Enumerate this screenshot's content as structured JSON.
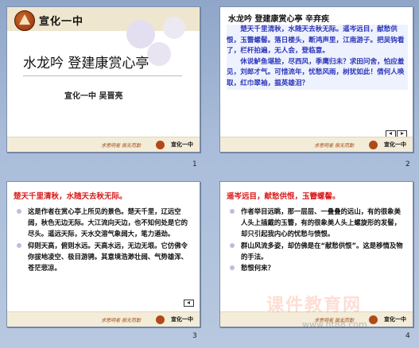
{
  "slides": [
    {
      "number": "1",
      "school": "宣化一中",
      "title": "水龙吟  登建康赏心亭",
      "author": "宣化一中    吴晋亮"
    },
    {
      "number": "2",
      "title": "水龙吟  登建康赏心亭  辛弃疾",
      "paragraphs": [
        "楚天千里清秋，水随天去秋无际。遥岑远目，献愁供恨，玉簪螺髻。落日楼头，断鸿声里，江南游子。把吴钩看了，栏杆拍遍，无人会，登临意。",
        "休说鲈鱼堪脍，尽西风，季鹰归未？求田问舍，怕应羞见，刘郎才气。可惜流年，忧愁风雨，树犹如此！倩何人唤取，红巾翠袖，揾英雄泪？"
      ]
    },
    {
      "number": "3",
      "heading": "楚天千里清秋，水随天去秋无际。",
      "items": [
        {
          "bullet": true,
          "text": "这是作者在赏心亭上所见的景色。楚天千里，辽远空阔，秋色无边无际。大江流向天边，也不知何处是它的尽头。遥远天际，天水交溶气象阔大，笔力遒劲。"
        },
        {
          "bullet": false,
          "text": "仰则天高，俯则水远。天高水远，无边无垠。它仿佛令你拔地凌空、极目游骋。其意境浩渺壮阔、气势雄浑、苍茫悲凉。"
        }
      ]
    },
    {
      "number": "4",
      "heading": "遥岑远目，献愁供恨，玉簪螺髻。",
      "items": [
        {
          "bullet": true,
          "text": "作者举目远眺，那一层层、一叠叠的远山，有的很象美人头上插戴的玉簪，有的很象美人头上螺旋形的发髻，却只引起我内心的忧愁与愤恨。"
        },
        {
          "bullet": true,
          "text": "群山风流多姿，却仿佛是在“献愁供恨”。这是移情及物的手法。"
        },
        {
          "bullet": true,
          "text": "愁恨何来？"
        }
      ]
    }
  ],
  "footer": {
    "motto": "求思明者  振无而勤",
    "school": "宣化一中"
  },
  "watermark": {
    "text": "课件教育网",
    "url": "www.ht88.com"
  },
  "colors": {
    "background": "#a9bcd9",
    "slide_text_blue": "#2b35b8",
    "heading_red": "#d81b1b"
  },
  "icons": [
    "logo-icon",
    "prev-arrow-icon",
    "next-arrow-icon"
  ]
}
